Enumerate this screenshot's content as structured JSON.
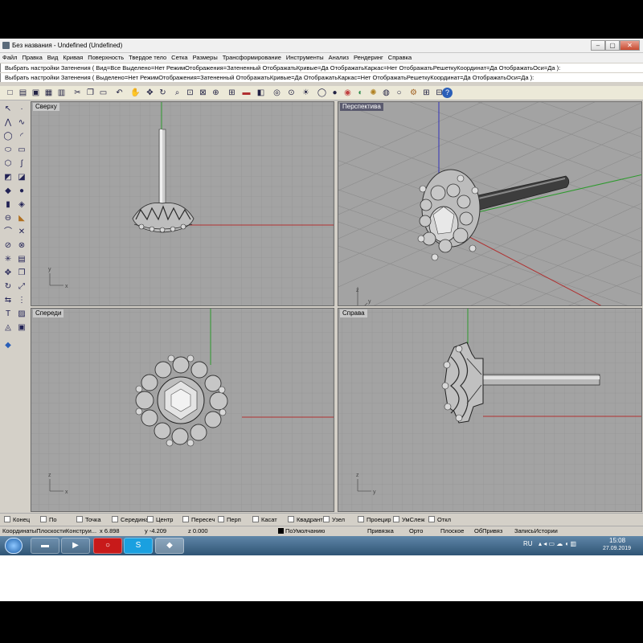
{
  "window": {
    "title": "Без названия - Undefined (Undefined)",
    "min": "–",
    "max": "▢",
    "close": "✕"
  },
  "menu": [
    "Файл",
    "Правка",
    "Вид",
    "Кривая",
    "Поверхность",
    "Твердое тело",
    "Сетка",
    "Размеры",
    "Трансформирование",
    "Инструменты",
    "Анализ",
    "Рендеринг",
    "Справка"
  ],
  "command": {
    "history": "Выбрать настройки Затенения ( Вид=Все  Выделено=Нет  РежимОтображения=Затененный  ОтображатьКривые=Да  ОтображатьКаркас=Нет  ОтображатьРешеткуКоординат=Да  ОтображатьОси=Да ):",
    "prompt": "Выбрать настройки Затенения ( Выделено=Нет  РежимОтображения=Затененный  ОтображатьКривые=Да  ОтображатьКаркас=Нет  ОтображатьРешеткуКоординат=Да  ОтображатьОси=Да ):"
  },
  "viewports": {
    "top": "Сверху",
    "perspective": "Перспектива",
    "front": "Спереди",
    "right": "Справа"
  },
  "axes": {
    "x": "x",
    "y": "y",
    "z": "z"
  },
  "osnap": [
    {
      "label": "Конец",
      "checked": false
    },
    {
      "label": "По",
      "checked": false
    },
    {
      "label": "Точка",
      "checked": false
    },
    {
      "label": "Середина",
      "checked": false
    },
    {
      "label": "Центр",
      "checked": false
    },
    {
      "label": "Пересеч",
      "checked": false
    },
    {
      "label": "Перп",
      "checked": false
    },
    {
      "label": "Касат",
      "checked": false
    },
    {
      "label": "Квадрант",
      "checked": false
    },
    {
      "label": "Узел",
      "checked": false
    },
    {
      "label": "Проецир",
      "checked": false
    },
    {
      "label": "УмСлеж",
      "checked": false
    },
    {
      "label": "Откл",
      "checked": false
    }
  ],
  "status": {
    "cplane": "КоординатыПлоскостиКонструи...",
    "x": "x 6.898",
    "y": "y -4.209",
    "z": "z 0.000",
    "layer": "ПоУмолчанию",
    "snap": "Привязка",
    "ortho": "Орто",
    "planar": "Плоское",
    "objsnap": "ОбПривяз",
    "history": "ЗаписьИстории"
  },
  "taskbar": {
    "lang": "RU",
    "time": "15:08",
    "date": "27.09.2019"
  },
  "colors": {
    "viewport_bg": "#a3a3a3",
    "x_axis": "#b03030",
    "y_axis": "#2d9a2d",
    "z_axis": "#3030b8"
  }
}
